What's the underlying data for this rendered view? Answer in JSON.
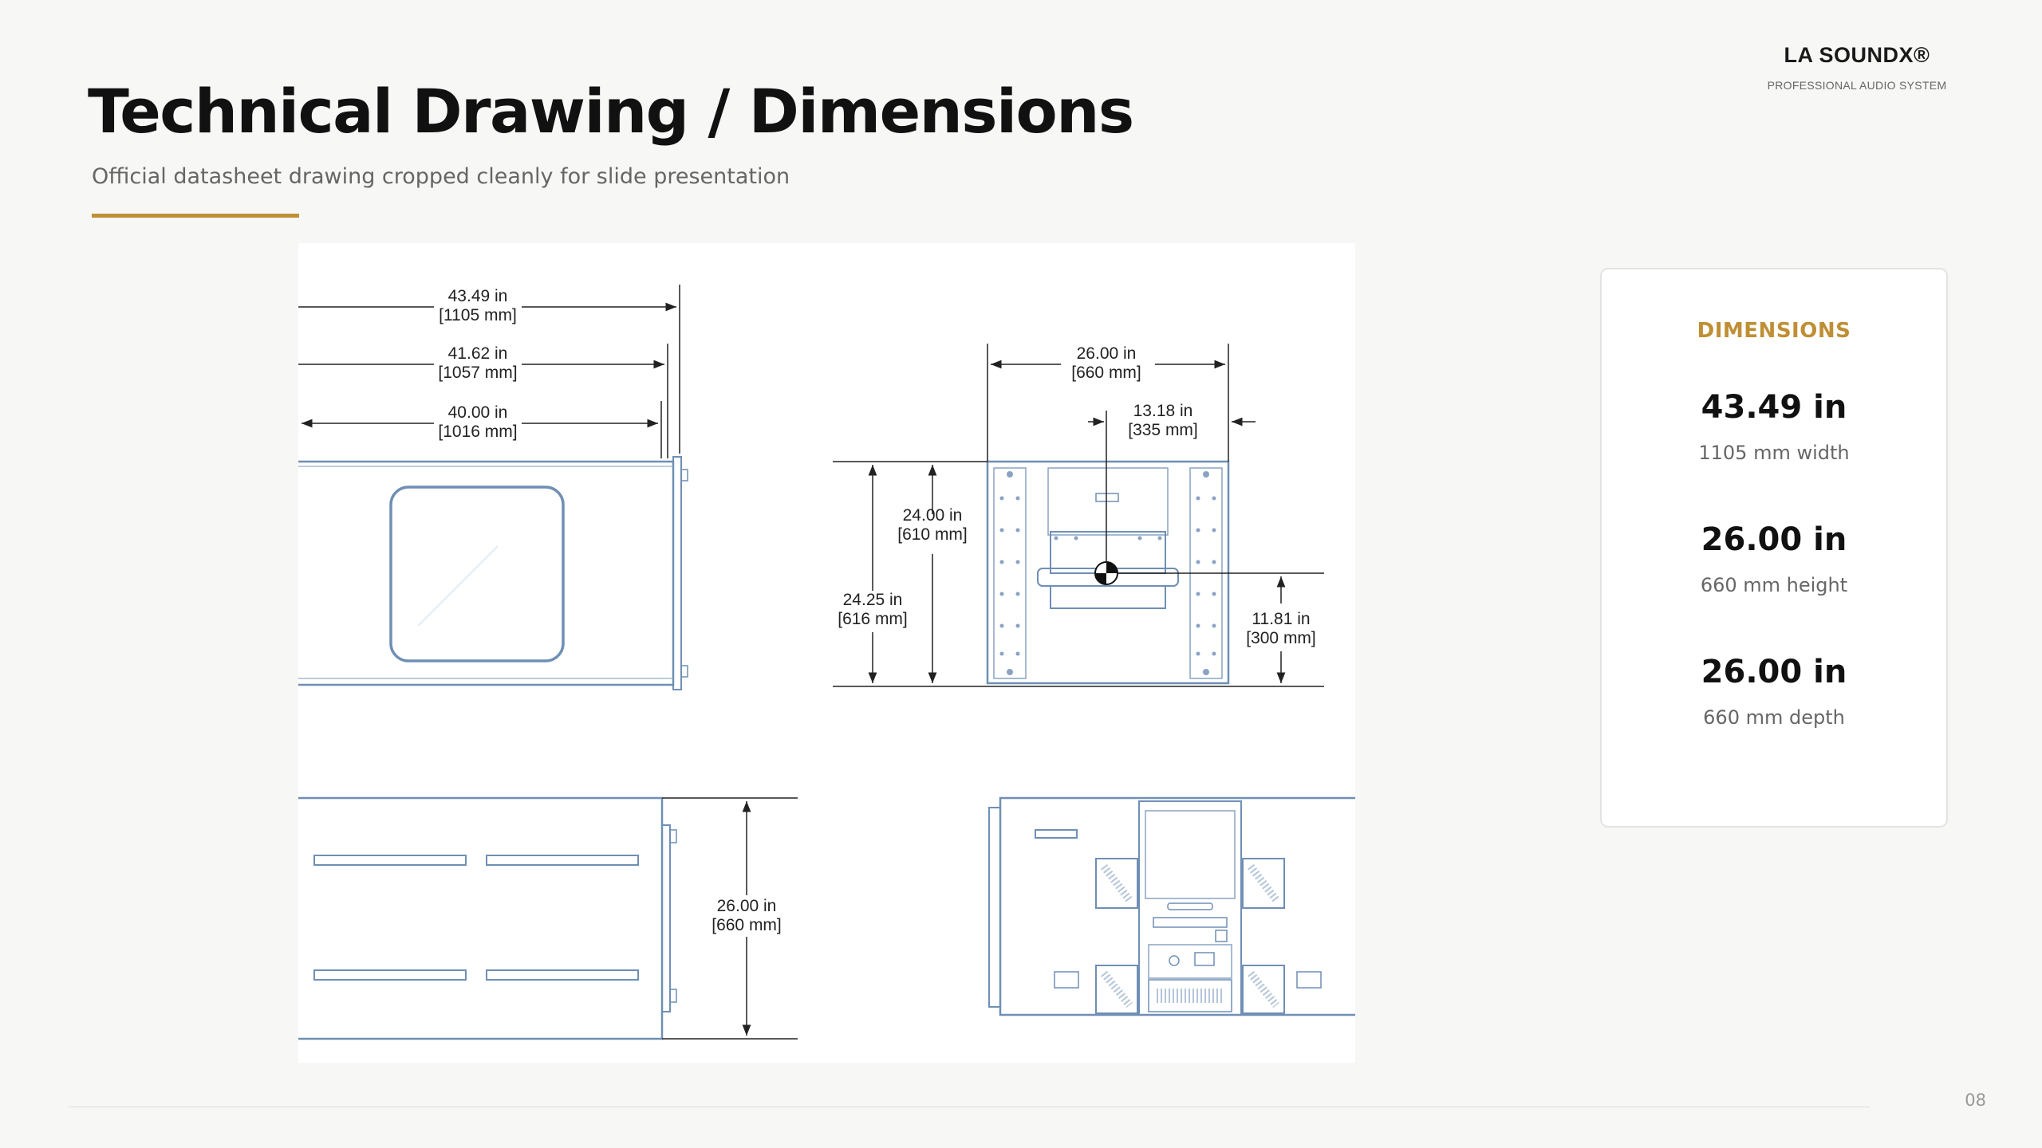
{
  "brand": {
    "name": "LA SOUNDX®",
    "tagline": "PROFESSIONAL AUDIO SYSTEM"
  },
  "slide": {
    "title": "Technical Drawing / Dimensions",
    "subtitle": "Official datasheet drawing cropped cleanly for slide presentation",
    "page_number": "08"
  },
  "colors": {
    "accent": "#bf8f35",
    "drawing_line": "#6f8fb5"
  },
  "drawing": {
    "side_view": {
      "width_overall": {
        "in": "43.49 in",
        "mm": "[1105 mm]"
      },
      "width_body": {
        "in": "41.62 in",
        "mm": "[1057 mm]"
      },
      "width_cabinet": {
        "in": "40.00 in",
        "mm": "[1016 mm]"
      }
    },
    "front_view": {
      "width": {
        "in": "26.00 in",
        "mm": "[660 mm]"
      },
      "center_offset": {
        "in": "13.18 in",
        "mm": "[335 mm]"
      },
      "height_cabinet": {
        "in": "24.00 in",
        "mm": "[610 mm]"
      },
      "height_overall": {
        "in": "24.25 in",
        "mm": "[616 mm]"
      },
      "center_height": {
        "in": "11.81 in",
        "mm": "[300 mm]"
      }
    },
    "top_view": {
      "depth": {
        "in": "26.00 in",
        "mm": "[660 mm]"
      }
    }
  },
  "dimensions_card": {
    "heading": "DIMENSIONS",
    "metrics": [
      {
        "value": "43.49 in",
        "label": "1105 mm width"
      },
      {
        "value": "26.00 in",
        "label": "660 mm height"
      },
      {
        "value": "26.00 in",
        "label": "660 mm depth"
      }
    ]
  }
}
